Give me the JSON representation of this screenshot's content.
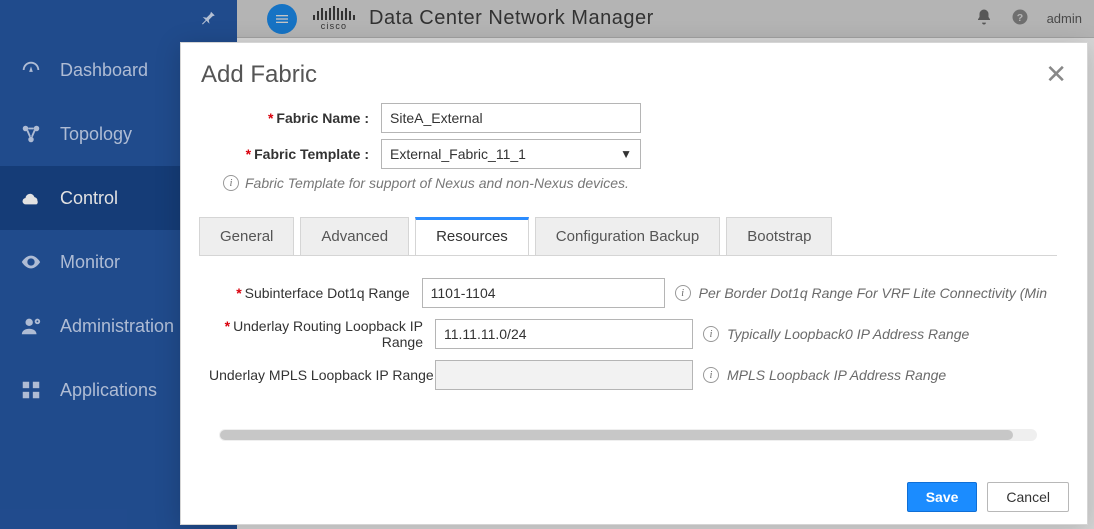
{
  "header": {
    "app_title": "Data Center Network Manager",
    "vendor": "cisco",
    "user": "admin"
  },
  "sidebar": {
    "items": [
      {
        "label": "Dashboard"
      },
      {
        "label": "Topology"
      },
      {
        "label": "Control"
      },
      {
        "label": "Monitor"
      },
      {
        "label": "Administration"
      },
      {
        "label": "Applications"
      }
    ]
  },
  "modal": {
    "title": "Add Fabric",
    "fabric_name_label": "Fabric Name :",
    "fabric_name_value": "SiteA_External",
    "fabric_template_label": "Fabric Template :",
    "fabric_template_value": "External_Fabric_11_1",
    "template_helper": "Fabric Template for support of Nexus and non-Nexus devices.",
    "tabs": [
      "General",
      "Advanced",
      "Resources",
      "Configuration Backup",
      "Bootstrap"
    ],
    "active_tab": "Resources",
    "resources": {
      "rows": [
        {
          "required": true,
          "label": "Subinterface Dot1q Range",
          "value": "1101-1104",
          "disabled": false,
          "desc": "Per Border Dot1q Range For VRF Lite Connectivity (Min"
        },
        {
          "required": true,
          "label": "Underlay Routing Loopback IP Range",
          "value": "11.11.11.0/24",
          "disabled": false,
          "desc": "Typically Loopback0 IP Address Range"
        },
        {
          "required": false,
          "label": "Underlay MPLS Loopback IP Range",
          "value": "",
          "disabled": true,
          "desc": "MPLS Loopback IP Address Range"
        }
      ]
    },
    "buttons": {
      "save": "Save",
      "cancel": "Cancel"
    }
  }
}
